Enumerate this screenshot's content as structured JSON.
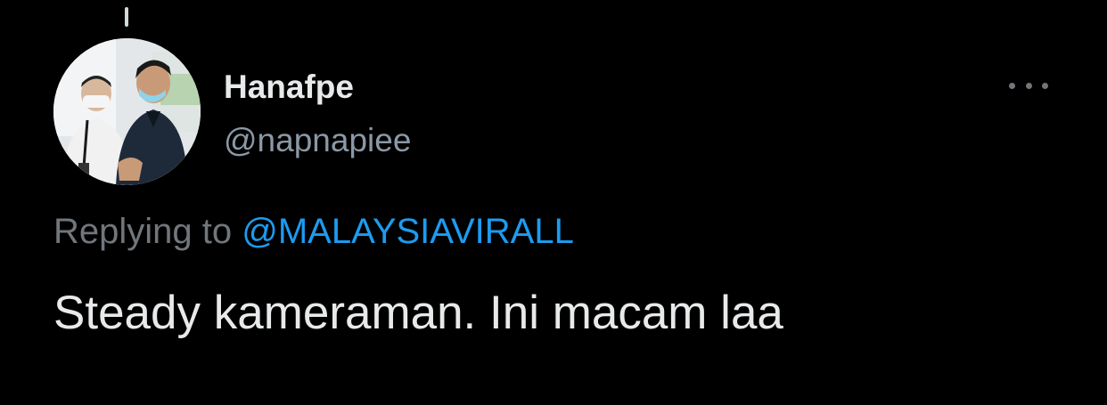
{
  "tweet": {
    "author": {
      "display_name": "Hanafpe",
      "handle": "@napnapiee",
      "avatar_icon": "profile-photo"
    },
    "reply": {
      "prefix": "Replying to",
      "mention": "@MALAYSIAVIRALL"
    },
    "text": "Steady kameraman. Ini macam laa",
    "more_icon": "more-horizontal-icon"
  },
  "colors": {
    "background": "#000000",
    "primary_text": "#e7e9ea",
    "secondary_text": "#71767b",
    "link": "#1d9bf0"
  }
}
